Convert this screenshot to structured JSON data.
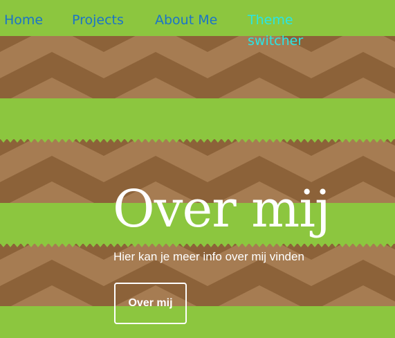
{
  "nav": {
    "items": [
      {
        "label": "Home"
      },
      {
        "label": "Projects"
      },
      {
        "label": "About Me"
      },
      {
        "label": "Theme switcher"
      }
    ]
  },
  "hero": {
    "title": "Over mij",
    "subtitle": "Hier kan je meer info over mij vinden",
    "button_label": "Over mij"
  },
  "colors": {
    "grass": "#8cc63f",
    "dirt_dark": "#8c6239",
    "dirt_light": "#a67c52",
    "nav_link": "#1a73c9",
    "theme_link": "#28e6e6",
    "hero_text": "#ffffff"
  }
}
